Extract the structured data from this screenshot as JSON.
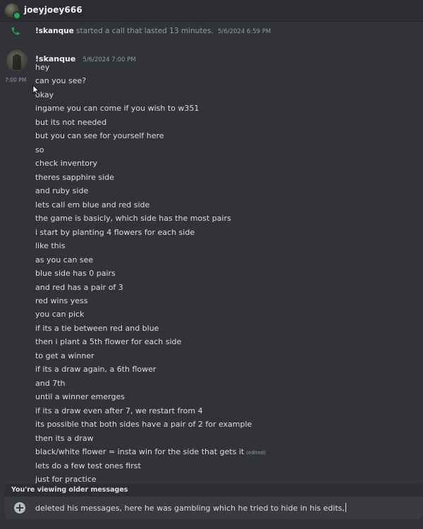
{
  "header": {
    "title": "joeyjoey666",
    "avatar_icon": "user-avatar",
    "status_color": "#23a55a"
  },
  "call_message": {
    "icon": "phone-icon",
    "author": "!skanque",
    "text": "started a call that lasted 13 minutes.",
    "timestamp": "5/6/2024 6:59 PM",
    "icon_color": "#23a55a"
  },
  "message_group": {
    "author": "!skanque",
    "timestamp": "5/6/2024 7:00 PM",
    "hover_timestamp": "7:00 PM",
    "lines": [
      "hey",
      "can you see?",
      "okay",
      "ingame you can come if you wish to w351",
      "but its not needed",
      "but you can see for yourself here",
      "so",
      "check inventory",
      "theres sapphire side",
      "and ruby side",
      "lets call em blue and red side",
      "the game is basicly, which side has the most pairs",
      "i start by planting 4 flowers for each side",
      "like this",
      "as you can see",
      "blue side has 0 pairs",
      "and red has a pair of 3",
      "red wins yess",
      "you can pick",
      "if its a tie between red and blue",
      "then i plant a 5th flower for each side",
      "to get a winner",
      "if its a draw again, a 6th flower",
      "and 7th",
      "until a winner emerges",
      "if its a draw even after 7, we restart from 4",
      "its possible that both sides have a pair of 2 for example",
      "then its a draw",
      "black/white flower = insta win for the side that gets it",
      "lets do a few test ones first",
      "just for practice"
    ],
    "edited_label": "(edited)"
  },
  "older_messages_bar": {
    "text": "You're viewing older messages"
  },
  "composer": {
    "value": "deleted his messages, here he was gambling which he tried to hide in his edits,",
    "add_icon": "plus-circle-icon"
  }
}
